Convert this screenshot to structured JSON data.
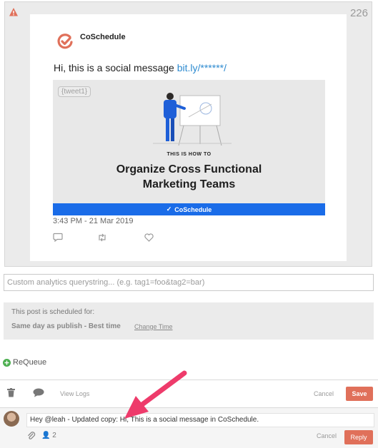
{
  "post": {
    "char_count": "226",
    "account_name": "CoSchedule",
    "message_text": "Hi, this is a social message ",
    "message_link": "bit.ly/******/",
    "image_tag": "{tweet1}",
    "image_kicker": "THIS IS HOW TO",
    "image_headline_1": "Organize Cross Functional",
    "image_headline_2": "Marketing Teams",
    "image_brand": "CoSchedule",
    "timestamp": "3:43 PM - 21 Mar 2019"
  },
  "analytics": {
    "placeholder": "Custom analytics querystring... (e.g. tag1=foo&tag2=bar)"
  },
  "schedule": {
    "label": "This post is scheduled for:",
    "value": "Same day as publish - Best time",
    "change_link": "Change Time"
  },
  "requeue_label": "ReQueue",
  "toolbar": {
    "view_logs": "View Logs",
    "cancel": "Cancel",
    "save": "Save"
  },
  "comment": {
    "text": "Hey @leah - Updated copy: Hi, This is a social message in CoSchedule.",
    "assignee_count": "2",
    "cancel": "Cancel",
    "reply": "Reply"
  },
  "colors": {
    "accent": "#e0705a",
    "link": "#2e8bd0",
    "banner": "#1a6ce8",
    "arrow": "#ee3b6b"
  }
}
